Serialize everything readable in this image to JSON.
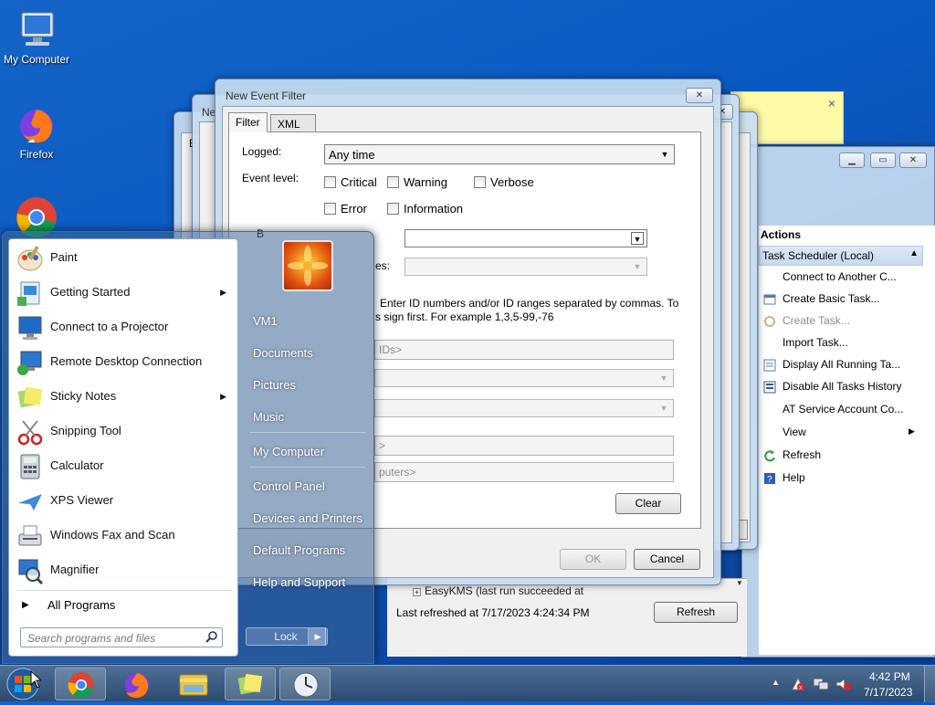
{
  "desktop": {
    "icons": [
      {
        "label": "My Computer",
        "icon": "computer-icon"
      },
      {
        "label": "Firefox",
        "icon": "firefox-icon"
      },
      {
        "label": "",
        "icon": "chrome-icon"
      }
    ]
  },
  "task_scheduler": {
    "actions_header": "Actions",
    "section": "Task Scheduler (Local)",
    "items": [
      "Connect to Another C...",
      "Create Basic Task...",
      "Create Task...",
      "Import Task...",
      "Display All Running Ta...",
      "Disable All Tasks History",
      "AT Service Account Co...",
      "View",
      "Refresh",
      "Help"
    ],
    "tree_item": "EasyKMS (last run succeeded at",
    "last_refreshed": "Last refreshed at 7/17/2023 4:24:34 PM",
    "refresh_button": "Refresh"
  },
  "back_dialogs": {
    "title_fragment": "Ne",
    "tab_fragment": "E"
  },
  "dialog": {
    "title": "New Event Filter",
    "tabs": [
      "Filter",
      "XML"
    ],
    "logged_label": "Logged:",
    "logged_value": "Any time",
    "event_level_label": "Event level:",
    "levels": [
      "Critical",
      "Warning",
      "Verbose",
      "Error",
      "Information"
    ],
    "by_fragment": "B",
    "sources_fragment": "es:",
    "id_help_line1": "Enter ID numbers and/or ID ranges separated by commas. To",
    "id_help_line2": "s sign first. For example 1,3,5-99,-76",
    "ids_placeholder": "IDs>",
    "user_placeholder": ">",
    "computer_placeholder": "puters>",
    "clear_button": "Clear",
    "ok_button": "OK",
    "cancel_button": "Cancel"
  },
  "start_menu": {
    "programs": [
      {
        "label": "Paint",
        "icon": "paint-icon",
        "submenu": false
      },
      {
        "label": "Getting Started",
        "icon": "getting-started-icon",
        "submenu": true
      },
      {
        "label": "Connect to a Projector",
        "icon": "projector-icon",
        "submenu": false
      },
      {
        "label": "Remote Desktop Connection",
        "icon": "remote-desktop-icon",
        "submenu": false
      },
      {
        "label": "Sticky Notes",
        "icon": "sticky-notes-icon",
        "submenu": true
      },
      {
        "label": "Snipping Tool",
        "icon": "snipping-tool-icon",
        "submenu": false
      },
      {
        "label": "Calculator",
        "icon": "calculator-icon",
        "submenu": false
      },
      {
        "label": "XPS Viewer",
        "icon": "xps-viewer-icon",
        "submenu": false
      },
      {
        "label": "Windows Fax and Scan",
        "icon": "fax-scan-icon",
        "submenu": false
      },
      {
        "label": "Magnifier",
        "icon": "magnifier-icon",
        "submenu": false
      }
    ],
    "all_programs": "All Programs",
    "search_placeholder": "Search programs and files",
    "right_items": [
      "VM1",
      "Documents",
      "Pictures",
      "Music",
      "My Computer",
      "Control Panel",
      "Devices and Printers",
      "Default Programs",
      "Help and Support"
    ],
    "lock_button": "Lock"
  },
  "taskbar": {
    "time": "4:42 PM",
    "date": "7/17/2023",
    "pinned": [
      "chrome-icon",
      "firefox-icon",
      "explorer-icon",
      "sticky-notes-icon",
      "task-scheduler-icon"
    ]
  }
}
